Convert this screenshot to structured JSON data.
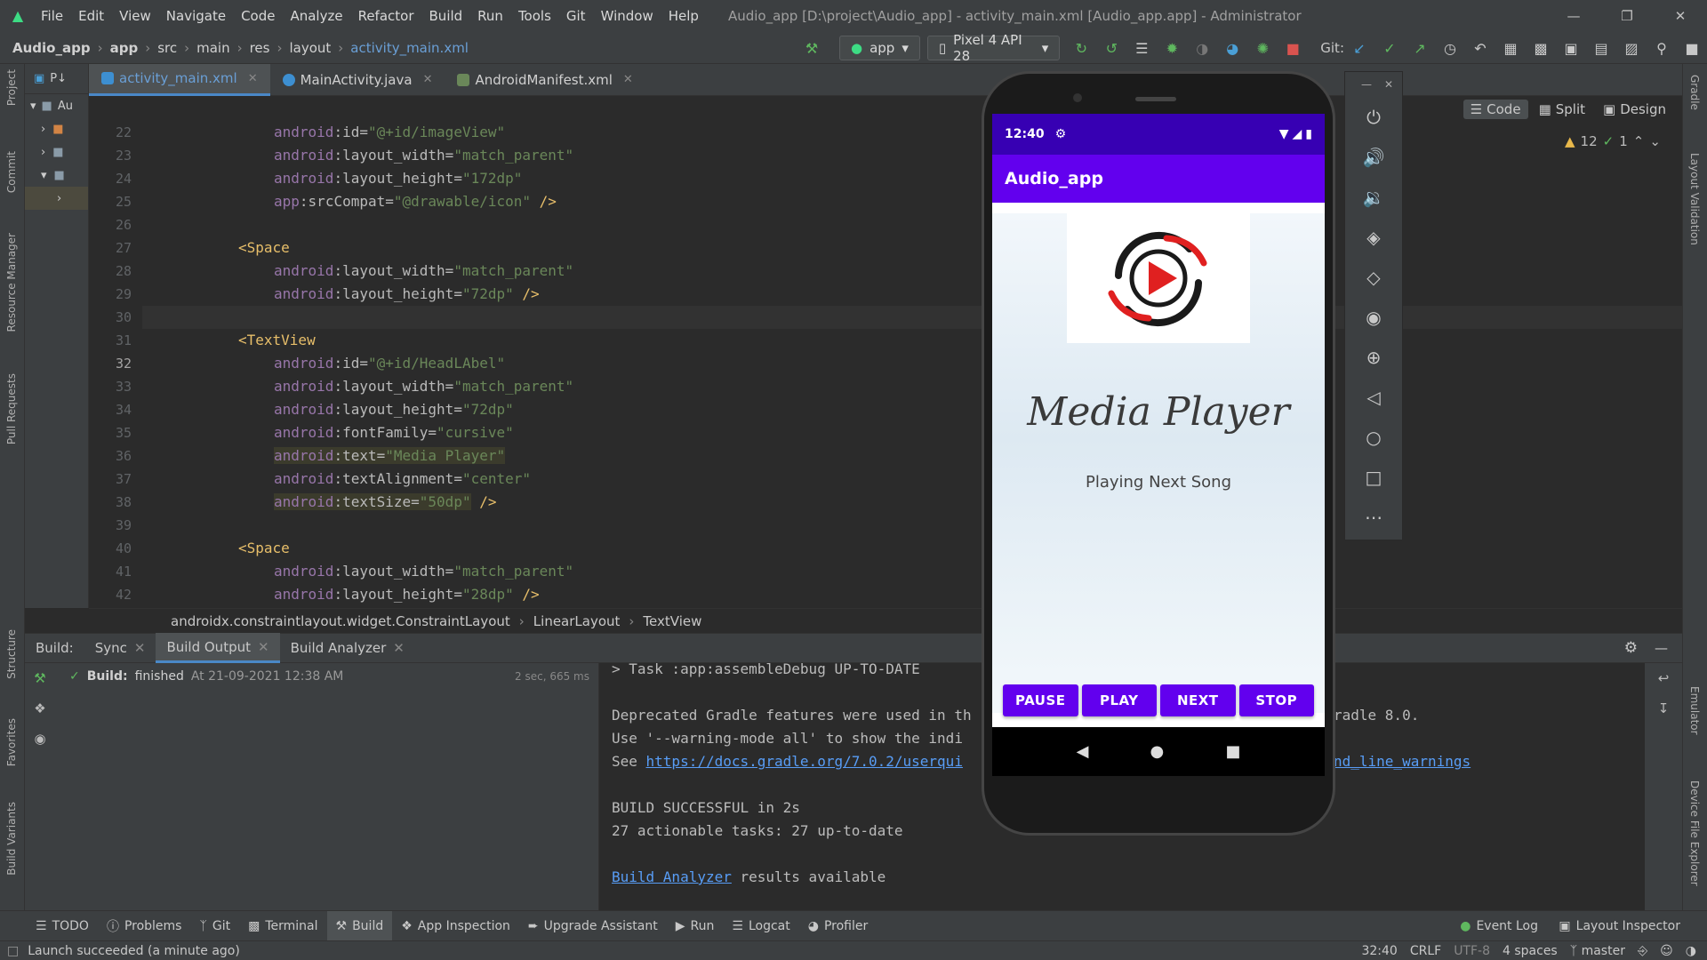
{
  "menubar": {
    "items": [
      "File",
      "Edit",
      "View",
      "Navigate",
      "Code",
      "Analyze",
      "Refactor",
      "Build",
      "Run",
      "Tools",
      "Git",
      "Window",
      "Help"
    ],
    "window_title": "Audio_app [D:\\project\\Audio_app] - activity_main.xml [Audio_app.app] - Administrator"
  },
  "navbar": {
    "crumbs": [
      "Audio_app",
      "app",
      "src",
      "main",
      "res",
      "layout"
    ],
    "file": "activity_main.xml",
    "run_config": "app",
    "device": "Pixel 4 API 28",
    "git_label": "Git:"
  },
  "left_strip": {
    "project": "Project",
    "commit": "Commit",
    "resource_manager": "Resource Manager",
    "pull_requests": "Pull Requests",
    "structure": "Structure",
    "favorites": "Favorites",
    "build_variants": "Build Variants"
  },
  "right_strip": {
    "gradle": "Gradle",
    "layout_validation": "Layout Validation",
    "emulator": "Emulator",
    "device_file_explorer": "Device File Explorer"
  },
  "project_panel": {
    "tab_label": "P↓",
    "root_label": "Au"
  },
  "tabs": [
    {
      "label": "activity_main.xml",
      "color": "#3d8fd1"
    },
    {
      "label": "MainActivity.java",
      "color": "#3d8fd1"
    },
    {
      "label": "AndroidManifest.xml",
      "color": "#6a8759"
    }
  ],
  "editor": {
    "view_modes": [
      "Code",
      "Split",
      "Design"
    ],
    "warnings": "12",
    "checks": "1",
    "line_numbers": [
      "22",
      "23",
      "24",
      "25",
      "26",
      "27",
      "28",
      "29",
      "30",
      "31",
      "32",
      "33",
      "34",
      "35",
      "36",
      "37",
      "38",
      "39",
      "40",
      "41",
      "42"
    ],
    "current_line": "32",
    "lines": [
      {
        "ns": "android",
        "attr": "id",
        "val": "\"@+id/imageView\"",
        "close": ""
      },
      {
        "ns": "android",
        "attr": "layout_width",
        "val": "\"match_parent\"",
        "close": ""
      },
      {
        "ns": "android",
        "attr": "layout_height",
        "val": "\"172dp\"",
        "close": ""
      },
      {
        "ns": "app",
        "attr": "srcCompat",
        "val": "\"@drawable/icon\"",
        "close": " />"
      },
      {
        "blank": true
      },
      {
        "tag": "<Space"
      },
      {
        "ns": "android",
        "attr": "layout_width",
        "val": "\"match_parent\"",
        "close": ""
      },
      {
        "ns": "android",
        "attr": "layout_height",
        "val": "\"72dp\"",
        "close": " />"
      },
      {
        "blank": true
      },
      {
        "tag": "<TextView"
      },
      {
        "ns": "android",
        "attr": "id",
        "val": "\"@+id/HeadLAbel\"",
        "close": ""
      },
      {
        "ns": "android",
        "attr": "layout_width",
        "val": "\"match_parent\"",
        "close": ""
      },
      {
        "ns": "android",
        "attr": "layout_height",
        "val": "\"72dp\"",
        "close": ""
      },
      {
        "ns": "android",
        "attr": "fontFamily",
        "val": "\"cursive\"",
        "close": ""
      },
      {
        "ns": "android",
        "attr": "text",
        "val": "\"Media Player\"",
        "close": "",
        "hl": true
      },
      {
        "ns": "android",
        "attr": "textAlignment",
        "val": "\"center\"",
        "close": ""
      },
      {
        "ns": "android",
        "attr": "textSize",
        "val": "\"50dp\"",
        "close": " />",
        "hl": true
      },
      {
        "blank": true
      },
      {
        "tag": "<Space"
      },
      {
        "ns": "android",
        "attr": "layout_width",
        "val": "\"match_parent\"",
        "close": ""
      },
      {
        "ns": "android",
        "attr": "layout_height",
        "val": "\"28dp\"",
        "close": " />"
      }
    ]
  },
  "editor_breadcrumb": [
    "androidx.constraintlayout.widget.ConstraintLayout",
    "LinearLayout",
    "TextView"
  ],
  "build": {
    "label": "Build:",
    "tabs": [
      "Sync",
      "Build Output",
      "Build Analyzer"
    ],
    "tree_item": "Build:",
    "tree_status": "finished",
    "tree_time": "At 21-09-2021 12:38 AM",
    "duration": "2 sec, 665 ms",
    "output": {
      "task_line": "> Task :app:assembleDebug UP-TO-DATE",
      "deprecated_1": "Deprecated Gradle features were used in th",
      "deprecated_1_tail": "radle 8.0.",
      "deprecated_2": "Use '--warning-mode all' to show the indi",
      "see": "See ",
      "link": "https://docs.gradle.org/7.0.2/userqui",
      "link_tail": "nd_line_warnings",
      "success": "BUILD SUCCESSFUL in 2s",
      "tasks": "27 actionable tasks: 27 up-to-date",
      "analyzer_link": "Build Analyzer",
      "analyzer_tail": " results available"
    }
  },
  "bottom_tools": [
    "TODO",
    "Problems",
    "Git",
    "Terminal",
    "Build",
    "App Inspection",
    "Upgrade Assistant",
    "Run",
    "Logcat",
    "Profiler"
  ],
  "bottom_right_tools": [
    "Event Log",
    "Layout Inspector"
  ],
  "statusbar": {
    "message": "Launch succeeded (a minute ago)",
    "position": "32:40",
    "line_sep": "CRLF",
    "encoding": "UTF-8",
    "indent": "4 spaces",
    "branch": "master"
  },
  "emulator": {
    "time": "12:40",
    "app_title": "Audio_app",
    "heading": "Media Player",
    "subtitle": "Playing Next Song",
    "buttons": [
      "PAUSE",
      "PLAY",
      "NEXT",
      "STOP"
    ]
  },
  "colors": {
    "accent": "#6200ee",
    "status_bar": "#3700b3",
    "link": "#589df6"
  }
}
